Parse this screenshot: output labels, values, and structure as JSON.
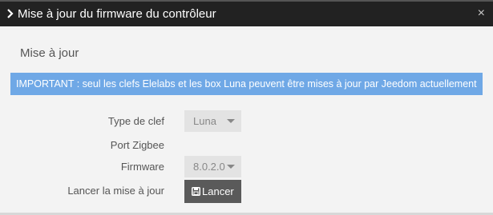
{
  "window": {
    "title": "Mise à jour du firmware du contrôleur",
    "close_glyph": "×"
  },
  "section": {
    "title": "Mise à jour"
  },
  "alert": {
    "text": "IMPORTANT : seul les clefs Elelabs et les box Luna peuvent être mises à jour par Jeedom actuellement",
    "color": "#6fa8e6"
  },
  "form": {
    "key_type_label": "Type de clef",
    "key_type_value": "Luna",
    "port_label": "Port Zigbee",
    "firmware_label": "Firmware",
    "firmware_value": "8.0.2.0",
    "launch_label": "Lancer la mise à jour",
    "launch_button": "Lancer"
  },
  "icons": {
    "title_chevron": "chevron-right-icon",
    "button_icon": "floppy-disk-icon"
  }
}
